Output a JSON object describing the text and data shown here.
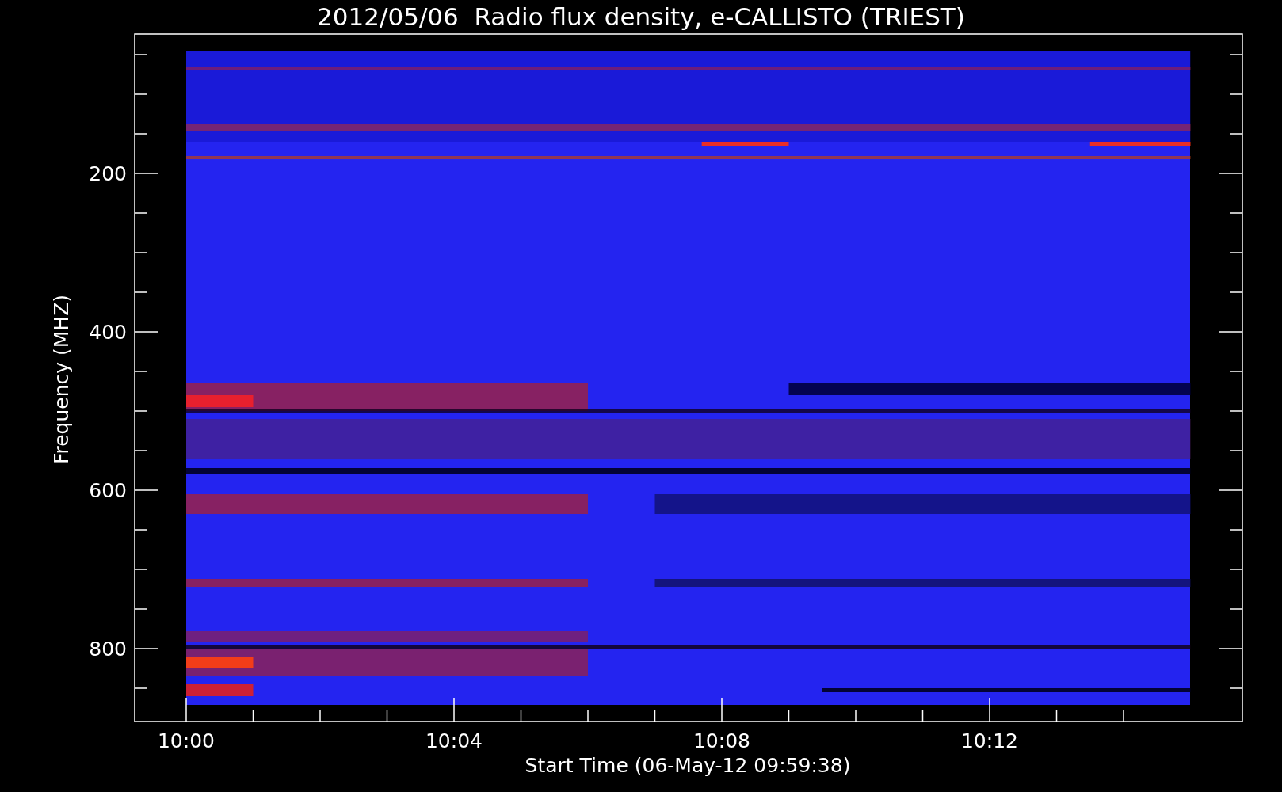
{
  "title": "2012/05/06  Radio flux density, e-CALLISTO (TRIEST)",
  "ylabel": "Frequency (MHZ)",
  "xlabel": "Start Time (06-May-12 09:59:38)",
  "yticks": [
    "200",
    "400",
    "600",
    "800"
  ],
  "xticks": [
    "10:00",
    "10:04",
    "10:08",
    "10:12"
  ]
}
